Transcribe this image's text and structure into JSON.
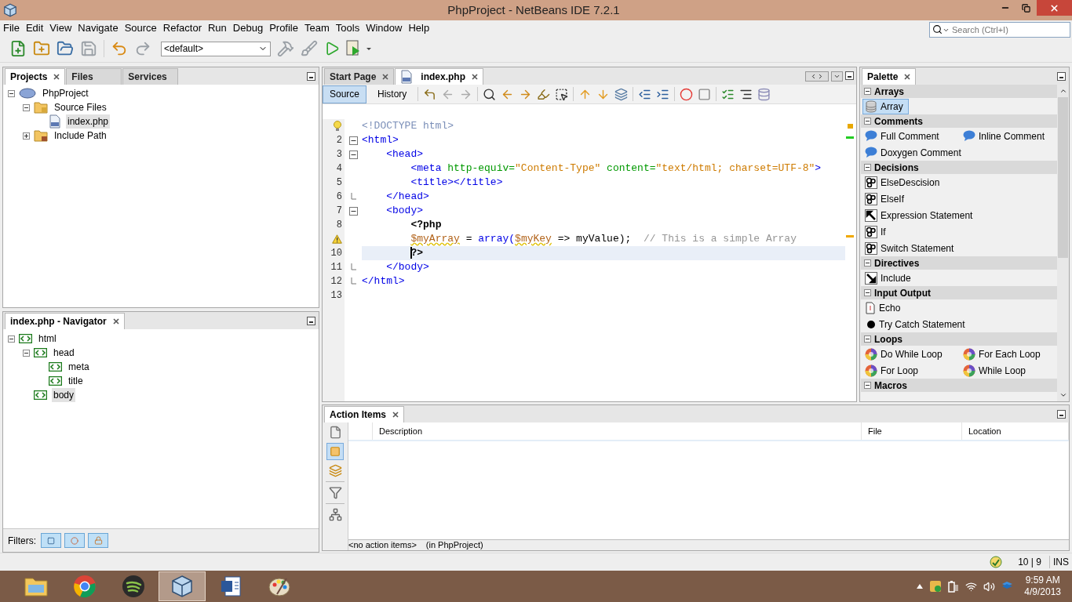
{
  "window": {
    "title": "PhpProject - NetBeans IDE 7.2.1"
  },
  "menu": [
    "File",
    "Edit",
    "View",
    "Navigate",
    "Source",
    "Refactor",
    "Run",
    "Debug",
    "Profile",
    "Team",
    "Tools",
    "Window",
    "Help"
  ],
  "search": {
    "placeholder": "Search (Ctrl+I)"
  },
  "toolbar": {
    "config": "<default>"
  },
  "projects_panel": {
    "tabs": [
      {
        "label": "Projects",
        "selected": true
      },
      {
        "label": "Files",
        "selected": false
      },
      {
        "label": "Services",
        "selected": false
      }
    ],
    "tree": [
      {
        "label": "PhpProject",
        "kind": "project",
        "expanded": true,
        "selected": false,
        "children": [
          {
            "label": "Source Files",
            "kind": "folder",
            "expanded": true,
            "selected": false,
            "children": [
              {
                "label": "index.php",
                "kind": "file",
                "selected": true
              }
            ]
          },
          {
            "label": "Include Path",
            "kind": "library",
            "expanded": false,
            "selected": false
          }
        ]
      }
    ]
  },
  "navigator": {
    "title": "index.php - Navigator",
    "filters_label": "Filters:",
    "tree": [
      {
        "label": "html",
        "kind": "tag",
        "expanded": true,
        "selected": false,
        "children": [
          {
            "label": "head",
            "kind": "tag",
            "expanded": true,
            "selected": false,
            "children": [
              {
                "label": "meta",
                "kind": "tag",
                "selected": false
              },
              {
                "label": "title",
                "kind": "tag",
                "selected": false
              }
            ]
          },
          {
            "label": "body",
            "kind": "tag",
            "selected": true
          }
        ]
      }
    ]
  },
  "editor": {
    "tabs": [
      {
        "label": "Start Page",
        "selected": false
      },
      {
        "label": "index.php",
        "selected": true
      }
    ],
    "views": [
      {
        "label": "Source",
        "selected": true
      },
      {
        "label": "History",
        "selected": false
      }
    ],
    "lines": [
      {
        "kind": "hint",
        "current": false,
        "fold_open": false,
        "fold_end": false,
        "tokens": [
          {
            "kind": "doctype",
            "text": "<!DOCTYPE html>"
          }
        ]
      },
      {
        "kind": "numbered",
        "number": "2",
        "current": false,
        "fold_open": true,
        "fold_end": false,
        "tokens": [
          {
            "kind": "tag",
            "text": "<html>"
          }
        ]
      },
      {
        "kind": "numbered",
        "number": "3",
        "current": false,
        "fold_open": true,
        "fold_end": false,
        "tokens": [
          {
            "kind": "tag",
            "text": "    <head>"
          }
        ]
      },
      {
        "kind": "numbered",
        "number": "4",
        "current": false,
        "fold_open": false,
        "fold_end": false,
        "tokens": [
          {
            "kind": "tag",
            "text": "        <meta "
          },
          {
            "kind": "attr",
            "text": "http-equiv="
          },
          {
            "kind": "string",
            "text": "\"Content-Type\" "
          },
          {
            "kind": "attr",
            "text": "content="
          },
          {
            "kind": "string",
            "text": "\"text/html; charset=UTF-8\""
          },
          {
            "kind": "tag",
            "text": ">"
          }
        ]
      },
      {
        "kind": "numbered",
        "number": "5",
        "current": false,
        "fold_open": false,
        "fold_end": false,
        "tokens": [
          {
            "kind": "tag",
            "text": "        <title></title>"
          }
        ]
      },
      {
        "kind": "numbered",
        "number": "6",
        "current": false,
        "fold_open": false,
        "fold_end": true,
        "tokens": [
          {
            "kind": "tag",
            "text": "    </head>"
          }
        ]
      },
      {
        "kind": "numbered",
        "number": "7",
        "current": false,
        "fold_open": true,
        "fold_end": false,
        "tokens": [
          {
            "kind": "tag",
            "text": "    <body>"
          }
        ]
      },
      {
        "kind": "numbered",
        "number": "8",
        "current": false,
        "fold_open": false,
        "fold_end": false,
        "tokens": [
          {
            "kind": "php",
            "text": "        <?php"
          }
        ]
      },
      {
        "kind": "warning",
        "current": false,
        "fold_open": false,
        "fold_end": false,
        "tokens": [
          {
            "kind": "var",
            "text": "        $myArray",
            "squiggle": true
          },
          {
            "kind": "plain",
            "text": " = "
          },
          {
            "kind": "keyword",
            "text": "array("
          },
          {
            "kind": "var",
            "text": "$myKey",
            "squiggle": true
          },
          {
            "kind": "plain",
            "text": " => myValue);  "
          },
          {
            "kind": "comment",
            "text": "// This is a simple Array"
          }
        ]
      },
      {
        "kind": "numbered",
        "number": "10",
        "current": true,
        "fold_open": false,
        "fold_end": false,
        "tokens": [
          {
            "kind": "php",
            "text": "        ?>",
            "caret": true
          }
        ]
      },
      {
        "kind": "numbered",
        "number": "11",
        "current": false,
        "fold_open": false,
        "fold_end": true,
        "tokens": [
          {
            "kind": "tag",
            "text": "    </body>"
          }
        ]
      },
      {
        "kind": "numbered",
        "number": "12",
        "current": false,
        "fold_open": false,
        "fold_end": true,
        "tokens": [
          {
            "kind": "tag",
            "text": "</html>"
          }
        ]
      },
      {
        "kind": "numbered",
        "number": "13",
        "current": false,
        "fold_open": false,
        "fold_end": false
      }
    ]
  },
  "palette": {
    "title": "Palette",
    "categories": [
      {
        "name": "Arrays",
        "items": [
          {
            "label": "Array",
            "kind": "stack",
            "selected": true
          }
        ]
      },
      {
        "name": "Comments",
        "items": [
          {
            "label": "Full Comment",
            "kind": "bubble",
            "selected": false
          },
          {
            "label": "Inline Comment",
            "kind": "bubble",
            "selected": false
          },
          {
            "label": "Doxygen Comment",
            "kind": "bubble",
            "selected": false
          }
        ]
      },
      {
        "name": "Decisions",
        "items": [
          {
            "label": "ElseDescision",
            "kind": "gears",
            "selected": false
          },
          {
            "label": "ElseIf",
            "kind": "gears",
            "selected": false
          },
          {
            "label": "Expression Statement",
            "kind": "arrow-up",
            "selected": false
          },
          {
            "label": "If",
            "kind": "gears",
            "selected": false
          },
          {
            "label": "Switch Statement",
            "kind": "gears",
            "selected": false
          }
        ]
      },
      {
        "name": "Directives",
        "items": [
          {
            "label": "Include",
            "kind": "arrow-down",
            "selected": false
          }
        ]
      },
      {
        "name": "Input Output",
        "items": [
          {
            "label": "Echo",
            "kind": "page",
            "selected": false
          },
          {
            "label": "Try Catch Statement",
            "kind": "dot",
            "selected": false
          }
        ]
      },
      {
        "name": "Loops",
        "items": [
          {
            "label": "Do While Loop",
            "kind": "wheel",
            "selected": false
          },
          {
            "label": "For Each Loop",
            "kind": "wheel",
            "selected": false
          },
          {
            "label": "For Loop",
            "kind": "wheel",
            "selected": false
          },
          {
            "label": "While Loop",
            "kind": "wheel",
            "selected": false
          }
        ]
      },
      {
        "name": "Macros"
      }
    ]
  },
  "action_items": {
    "title": "Action Items",
    "columns": [
      "Description",
      "File",
      "Location"
    ],
    "status": "<no action items>",
    "scope": "(in PhpProject)"
  },
  "status_bar": {
    "position": "10 | 9",
    "mode": "INS"
  },
  "taskbar": {
    "apps": [
      {
        "kind": "folder",
        "active": false
      },
      {
        "kind": "globe",
        "active": false
      },
      {
        "kind": "waves",
        "active": false
      },
      {
        "kind": "cube",
        "active": true
      },
      {
        "kind": "document",
        "active": false
      },
      {
        "kind": "palette",
        "active": false
      }
    ],
    "time": "9:59 AM",
    "date": "4/9/2013"
  }
}
